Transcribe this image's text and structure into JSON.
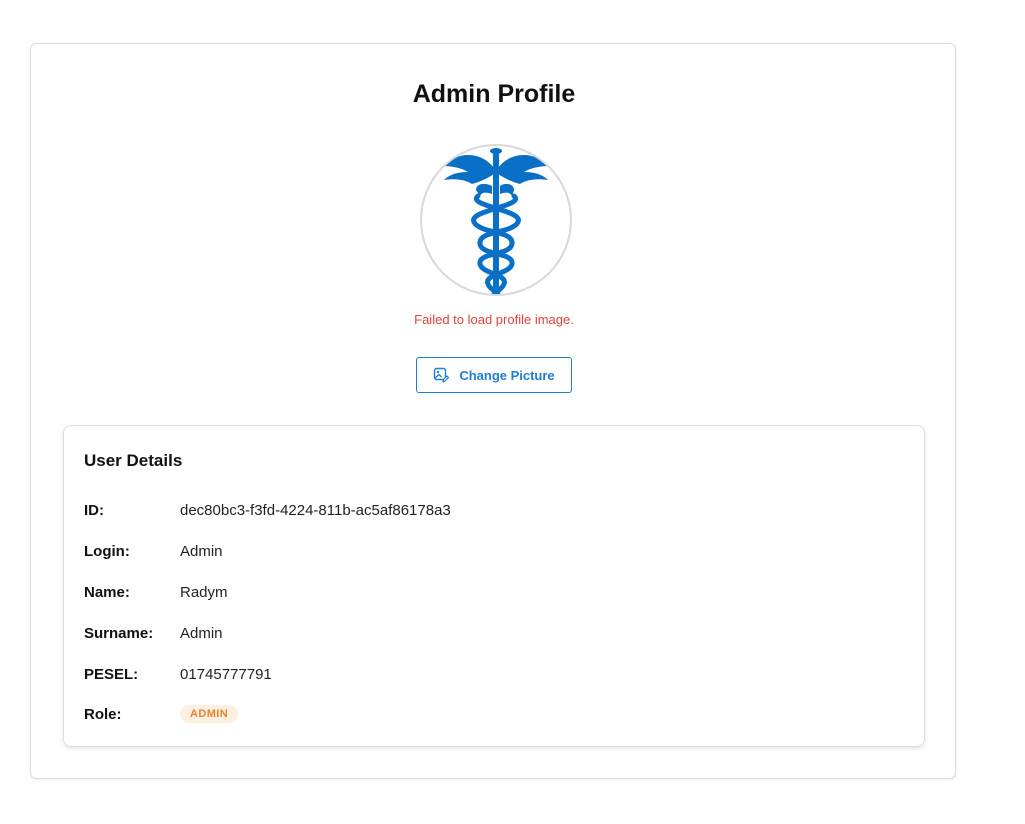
{
  "profile": {
    "title": "Admin Profile",
    "avatar_icon": "caduceus-icon",
    "error_message": "Failed to load profile image.",
    "change_picture_label": "Change Picture",
    "change_picture_icon": "image-edit-icon"
  },
  "details": {
    "title": "User Details",
    "rows": [
      {
        "label": "ID:",
        "value": "dec80bc3-f3fd-4224-811b-ac5af86178a3"
      },
      {
        "label": "Login:",
        "value": "Admin"
      },
      {
        "label": "Name:",
        "value": "Radym"
      },
      {
        "label": "Surname:",
        "value": "Admin"
      },
      {
        "label": "PESEL:",
        "value": "01745777791"
      },
      {
        "label": "Role:",
        "value": "ADMIN"
      }
    ]
  },
  "colors": {
    "accent": "#1f7fd2",
    "error": "#e0433a",
    "badge_bg": "#fdf0e2",
    "badge_text": "#e8822a"
  }
}
